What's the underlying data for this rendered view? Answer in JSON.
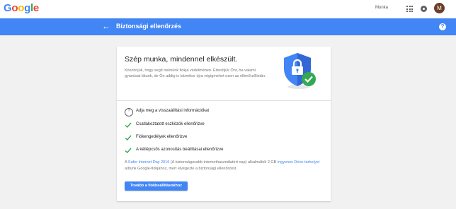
{
  "brand": {
    "logo_letters": [
      "G",
      "o",
      "o",
      "g",
      "l",
      "e"
    ],
    "logo_colors": [
      "#4285f4",
      "#ea4335",
      "#fbbc05",
      "#4285f4",
      "#34a853",
      "#ea4335"
    ]
  },
  "topbar": {
    "link": "Munka",
    "avatar_initial": "M",
    "apps_icon": "apps-grid-icon",
    "notifications_icon": "notifications-icon"
  },
  "header": {
    "title": "Biztonsági ellenőrzés",
    "back_icon": "arrow-back-icon",
    "help_icon": "help-icon",
    "color": "#4285f4"
  },
  "hero": {
    "title": "Szép munka, mindennel elkészült.",
    "description": "Köszönjük, hogy segít neknünk fiókja védelmében. Értesítjük Önt, ha valami gyanúsat látunk, de Ön addig is bármikor újra végigmehet ezen az ellenőrzőlistán.",
    "illustration": "shield-lock-check-icon"
  },
  "checklist": [
    {
      "icon": "help-circle-icon",
      "label": "Adja meg a visszaállítási információkat"
    },
    {
      "icon": "check-icon",
      "label": "Csatlakoztatott eszközök ellenőrizve"
    },
    {
      "icon": "check-icon",
      "label": "Fiókengedélyek ellenőrizve"
    },
    {
      "icon": "check-icon",
      "label": "A kétlépcsős azonosítás beállításai ellenőrizve"
    }
  ],
  "footnote": {
    "pre": "A ",
    "link1": "Safer Internet Day 2016",
    "mid": " (A biztonságosabb internethasználatért nap) alkalmából 2 GB ",
    "link2": "ingyenes Drive-tárhelyet",
    "post": " adtunk Google-fiókjához, mert elvégezte a biztonsági ellenőrzést."
  },
  "cta": {
    "label": "Tovább a fiókbeállításokhoz"
  },
  "colors": {
    "accent": "#4285f4",
    "check": "#34a853",
    "background": "#f1f1f1"
  }
}
